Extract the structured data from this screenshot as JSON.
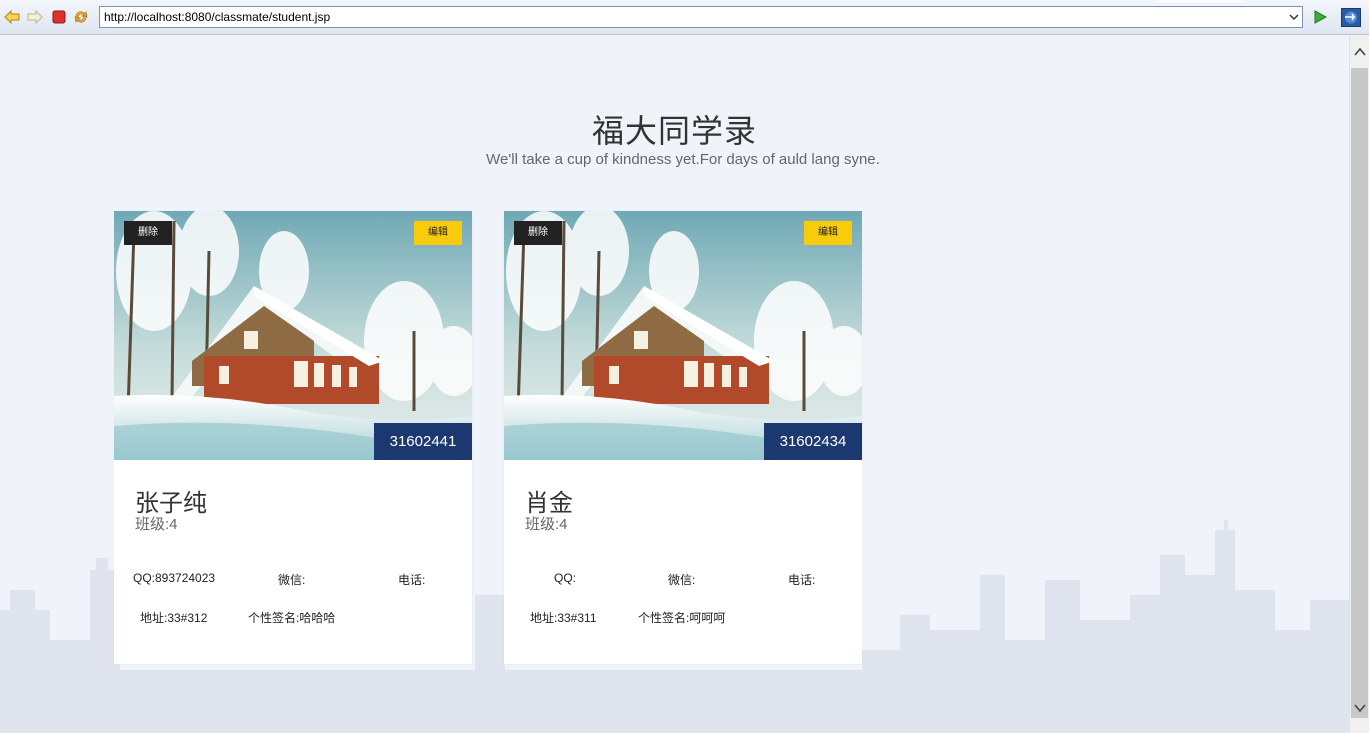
{
  "browser": {
    "url": "http://localhost:8080/classmate/student.jsp"
  },
  "page": {
    "title": "福大同学录",
    "subtitle": "We'll take a cup of kindness yet.For days of auld lang syne."
  },
  "cards": [
    {
      "id": "31602441",
      "name": "张子纯",
      "class": "班级:4",
      "qq": "QQ:893724023",
      "wechat": "微信:",
      "phone": "电话:",
      "address": "地址:33#312",
      "signature": "个性签名:哈哈哈",
      "delete_label": "删除",
      "edit_label": "编辑"
    },
    {
      "id": "31602434",
      "name": "肖金",
      "class": "班级:4",
      "qq": "QQ:",
      "wechat": "微信:",
      "phone": "电话:",
      "address": "地址:33#311",
      "signature": "个性签名:呵呵呵",
      "delete_label": "删除",
      "edit_label": "编辑"
    }
  ],
  "colors": {
    "badge": "#1b3870",
    "edit_button": "#f8cc0a",
    "delete_button": "#222222"
  }
}
